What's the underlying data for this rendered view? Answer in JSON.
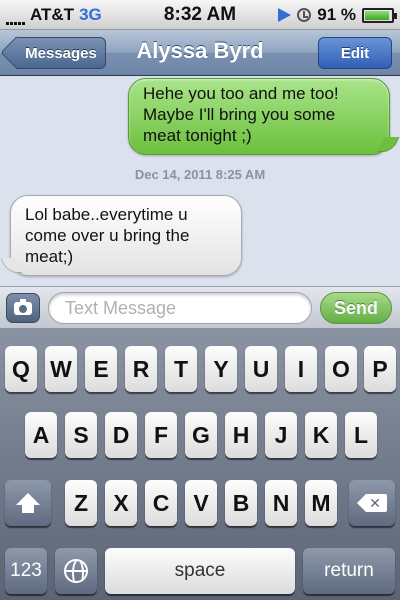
{
  "status_bar": {
    "carrier": "AT&T",
    "network": "3G",
    "time": "8:32 AM",
    "battery": "91 %",
    "battery_level": 0.91
  },
  "nav": {
    "back_label": "Messages",
    "title": "Alyssa Byrd",
    "edit_label": "Edit"
  },
  "messages": {
    "sent": "Hehe you too and me too! Maybe I'll bring you some meat tonight ;)",
    "timestamp": "Dec 14, 2011 8:25 AM",
    "received": "Lol babe..everytime u come over u bring the meat;)"
  },
  "composer": {
    "placeholder": "Text Message",
    "send_label": "Send"
  },
  "keyboard": {
    "row1": [
      "Q",
      "W",
      "E",
      "R",
      "T",
      "Y",
      "U",
      "I",
      "O",
      "P"
    ],
    "row2": [
      "A",
      "S",
      "D",
      "F",
      "G",
      "H",
      "J",
      "K",
      "L"
    ],
    "row3": [
      "Z",
      "X",
      "C",
      "V",
      "B",
      "N",
      "M"
    ],
    "numbers_label": "123",
    "space_label": "space",
    "return_label": "return"
  },
  "colors": {
    "sent_bubble": "#6cc03d",
    "received_bubble": "#ffffff",
    "nav_bar": "#7a91b1",
    "edit_button": "#2f5fb6"
  }
}
